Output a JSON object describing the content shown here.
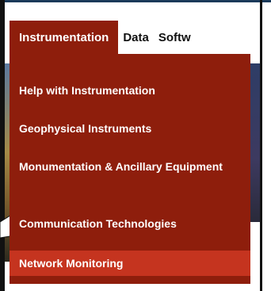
{
  "nav": {
    "items": [
      {
        "label": "Instrumentation",
        "active": true
      },
      {
        "label": "Data",
        "active": false
      },
      {
        "label": "Softw",
        "active": false
      }
    ]
  },
  "menu": {
    "items": [
      {
        "label": "Help with Instrumentation"
      },
      {
        "label": "Geophysical Instruments"
      },
      {
        "label": "Monumentation & Ancillary Equipment"
      },
      {
        "label": "Communication Technologies"
      },
      {
        "label": "Network Monitoring",
        "highlighted": true
      }
    ]
  },
  "colors": {
    "menu_bg": "#8e1e0c",
    "menu_highlight": "#c5341f",
    "nav_active_bg": "#8e1e0c"
  }
}
